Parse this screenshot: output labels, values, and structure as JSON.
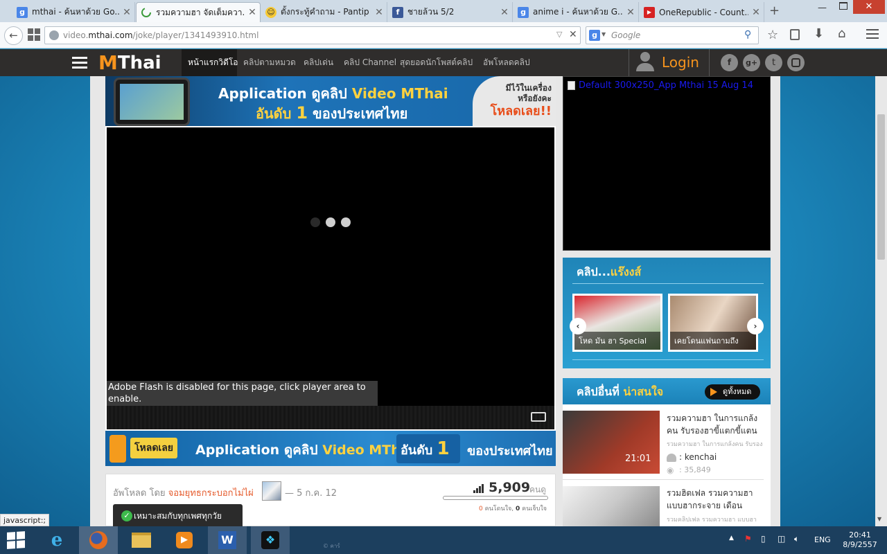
{
  "browser": {
    "tabs": [
      {
        "label": "mthai - ค้นหาด้วย Go...",
        "icon": "google-icon"
      },
      {
        "label": "รวมความฮา จัดเต็มควา...",
        "icon": "loading-icon"
      },
      {
        "label": "ตั้งกระทู้คำถาม - Pantip",
        "icon": "pantip-icon"
      },
      {
        "label": "ชายล้วน 5/2",
        "icon": "facebook-icon"
      },
      {
        "label": "anime i - ค้นหาด้วย G...",
        "icon": "google-icon"
      },
      {
        "label": "OneRepublic - Count...",
        "icon": "youtube-icon"
      }
    ],
    "url_domain": "video.",
    "url_host": "mthai.com",
    "url_path": "/joke/player/1341493910.html",
    "search_placeholder": "Google",
    "status_text": "javascript:;"
  },
  "site": {
    "logo_m": "M",
    "logo_thai": "Thai",
    "nav": [
      "หน้าแรกวิดีโอ",
      "คลิปตามหมวด",
      "คลิปเด่น",
      "คลิป Channel",
      "สุดยอดนักโพสต์คลิป",
      "อัพโหลดคลิป"
    ],
    "login": "Login"
  },
  "banner_top": {
    "line1_a": "Application",
    "line1_b": "ดูคลิป",
    "line1_c": "Video MThai",
    "line2_a": "อันดับ",
    "line2_num": "1",
    "line2_b": "ของประเทศไทย",
    "right_1": "มีไว้ในเครื่อง",
    "right_2": "หรือยังคะ",
    "right_3": "โหลดเลย!!"
  },
  "player": {
    "flash_notice": "Adobe Flash is disabled for this page, click player area to enable."
  },
  "banner_bottom": {
    "load": "โหลดเลย",
    "app": "Application",
    "dl": "ดูคลิป",
    "vm": "Video MThai",
    "rank": "อันดับ",
    "num": "1",
    "country": "ของประเทศไทย"
  },
  "info": {
    "uploaded_by": "อัพโหลด โดย",
    "uploader": "จอมยุทธกระบอกไม่ไผ่",
    "date": "— 5 ก.ค. 12",
    "views": "5,909",
    "views_unit": "คนดู",
    "like_count": "0",
    "like_label": "คนโดนใจ,",
    "hurt_count": "0",
    "hurt_label": "คนเจ็บใจ",
    "rating": "เหมาะสมกับทุกเพศทุกวัย"
  },
  "sidebar": {
    "ad_label": "Default 300x250_App Mthai 15 Aug 14",
    "hot_title_a": "คลิป...",
    "hot_title_b": "แร๊งงส์",
    "hot_clips": [
      {
        "title": "โหด มัน ฮา Special"
      },
      {
        "title": "เคยโดนแฟนถามถึง"
      }
    ],
    "more_title_a": "คลิปอื่นที่",
    "more_title_b": "น่าสนใจ",
    "see_all": "ดูทั้งหมด",
    "clips": [
      {
        "title": "รวมความฮา ในการแกล้งคน รับรองฮาขี้แตกขี้แตน",
        "sub": "รวมความฮา ในการแกล้งคน รับรอง",
        "duration": "21:01",
        "user": ": kenchai",
        "views": ": 35,849"
      },
      {
        "title": "รวมฮิตเฟล รวมความฮา แบบฮากระจาย เดือน",
        "sub": "รวมคลิปเฟล รวมความฮา แบบฮา"
      }
    ]
  },
  "taskbar": {
    "lang": "ENG",
    "time": "20:41",
    "date": "8/9/2557",
    "ghost": "© คาร์"
  }
}
